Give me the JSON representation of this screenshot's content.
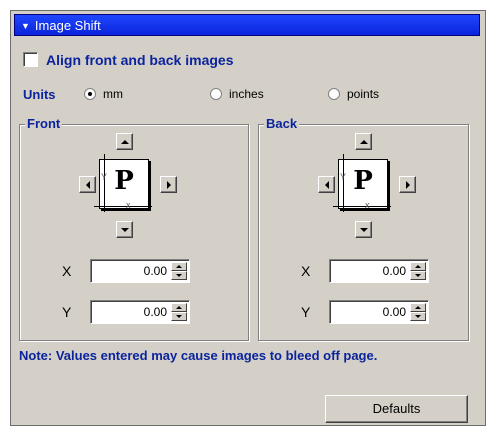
{
  "panel": {
    "title": "Image Shift",
    "align_label": "Align front and back images",
    "align_checked": false
  },
  "units": {
    "label": "Units",
    "options": [
      "mm",
      "inches",
      "points"
    ],
    "selected": "mm"
  },
  "front": {
    "title": "Front",
    "page_glyph": "P",
    "axis_y_mark": "Y",
    "axis_x_mark": "x",
    "x_label": "X",
    "x_value": "0.00",
    "y_label": "Y",
    "y_value": "0.00"
  },
  "back": {
    "title": "Back",
    "page_glyph": "P",
    "axis_y_mark": "Y",
    "axis_x_mark": "x",
    "x_label": "X",
    "x_value": "0.00",
    "y_label": "Y",
    "y_value": "0.00"
  },
  "note": "Note:  Values entered may cause images to bleed off page.",
  "defaults_label": "Defaults",
  "colors": {
    "title_bar": "#0a24d9",
    "label_blue": "#0b249e",
    "panel_bg": "#d4d0c8"
  }
}
